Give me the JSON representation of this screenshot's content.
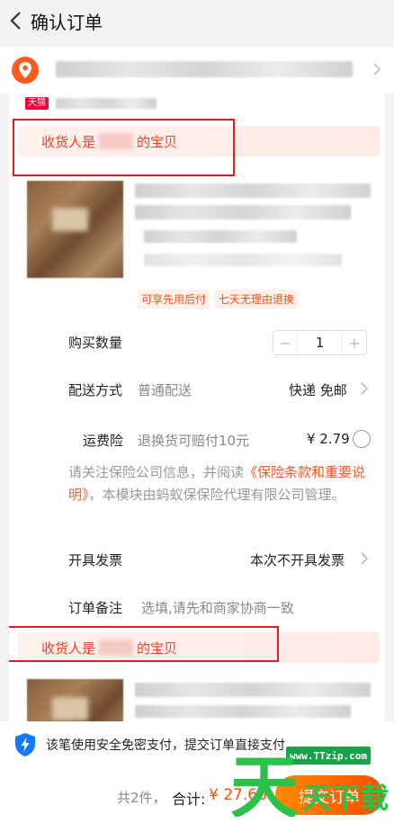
{
  "header": {
    "title": "确认订单"
  },
  "shop": {
    "badge": "天猫"
  },
  "gift_banner": {
    "prefix": "收货人是",
    "suffix": "的宝贝"
  },
  "tags": [
    "可享先用后付",
    "七天无理由退换"
  ],
  "quantity": {
    "label": "购买数量",
    "value": "1",
    "minus": "−",
    "plus": "+"
  },
  "delivery": {
    "label": "配送方式",
    "type": "普通配送",
    "value": "快递 免邮"
  },
  "insurance": {
    "label": "运费险",
    "desc": "退换货可赔付10元",
    "price": "¥ 2.79",
    "notice_part1": "请关注保险公司信息，并阅读",
    "notice_link": "《保险条款和重要说明》",
    "notice_part2": "，本模块由蚂蚁保保险代理有限公司管理。"
  },
  "invoice": {
    "label": "开具发票",
    "value": "本次不开具发票"
  },
  "remark": {
    "label": "订单备注",
    "placeholder": "选填,请先和商家协商一致"
  },
  "bottom": {
    "pay_note": "该笔使用安全免密支付，提交订单直接支付",
    "count": "共2件，",
    "total_label": "合计:",
    "total_value": "¥ 27.60",
    "submit": "提交订单"
  },
  "watermark": {
    "site": "www.TTzip.com",
    "text": "天天下载"
  },
  "colors": {
    "accent": "#ff5000",
    "gift_text": "#ff3d1f",
    "highlight_box": "#e51c23",
    "tmall": "#ff0036"
  }
}
